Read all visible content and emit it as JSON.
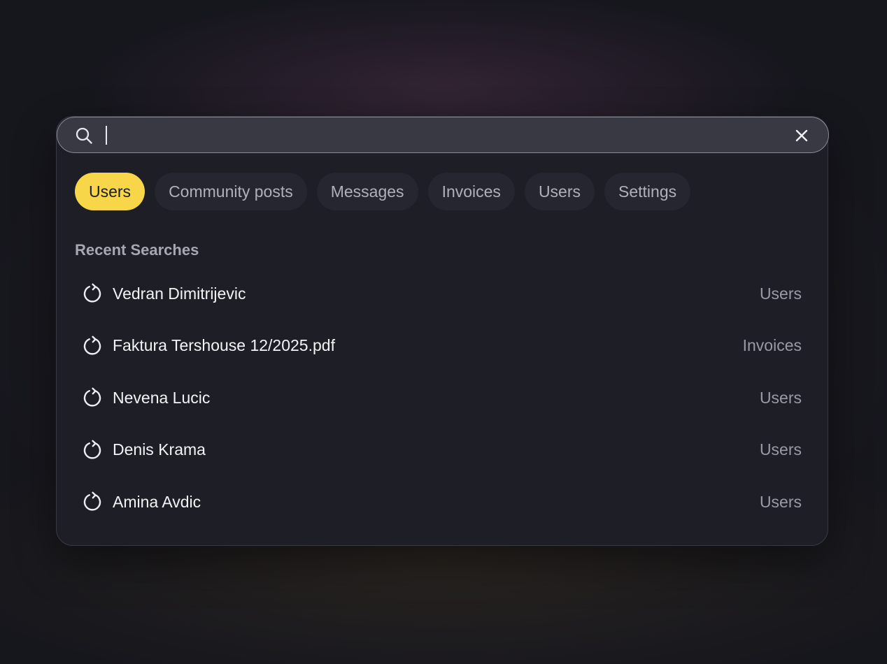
{
  "search": {
    "value": "",
    "placeholder": ""
  },
  "icons": {
    "search": "search-icon",
    "close": "close-icon",
    "history": "history-icon"
  },
  "filters": [
    {
      "label": "Users",
      "active": true
    },
    {
      "label": "Community posts",
      "active": false
    },
    {
      "label": "Messages",
      "active": false
    },
    {
      "label": "Invoices",
      "active": false
    },
    {
      "label": "Users",
      "active": false
    },
    {
      "label": "Settings",
      "active": false
    }
  ],
  "recent": {
    "title": "Recent Searches",
    "items": [
      {
        "label": "Vedran Dimitrijevic",
        "category": "Users"
      },
      {
        "label": "Faktura Tershouse 12/2025.pdf",
        "category": "Invoices"
      },
      {
        "label": "Nevena Lucic",
        "category": "Users"
      },
      {
        "label": "Denis Krama",
        "category": "Users"
      },
      {
        "label": "Amina Avdic",
        "category": "Users"
      }
    ]
  },
  "colors": {
    "accent": "#f7d64a",
    "background": "#16161d",
    "panel": "#1e1e27",
    "search_bar": "#393944"
  }
}
